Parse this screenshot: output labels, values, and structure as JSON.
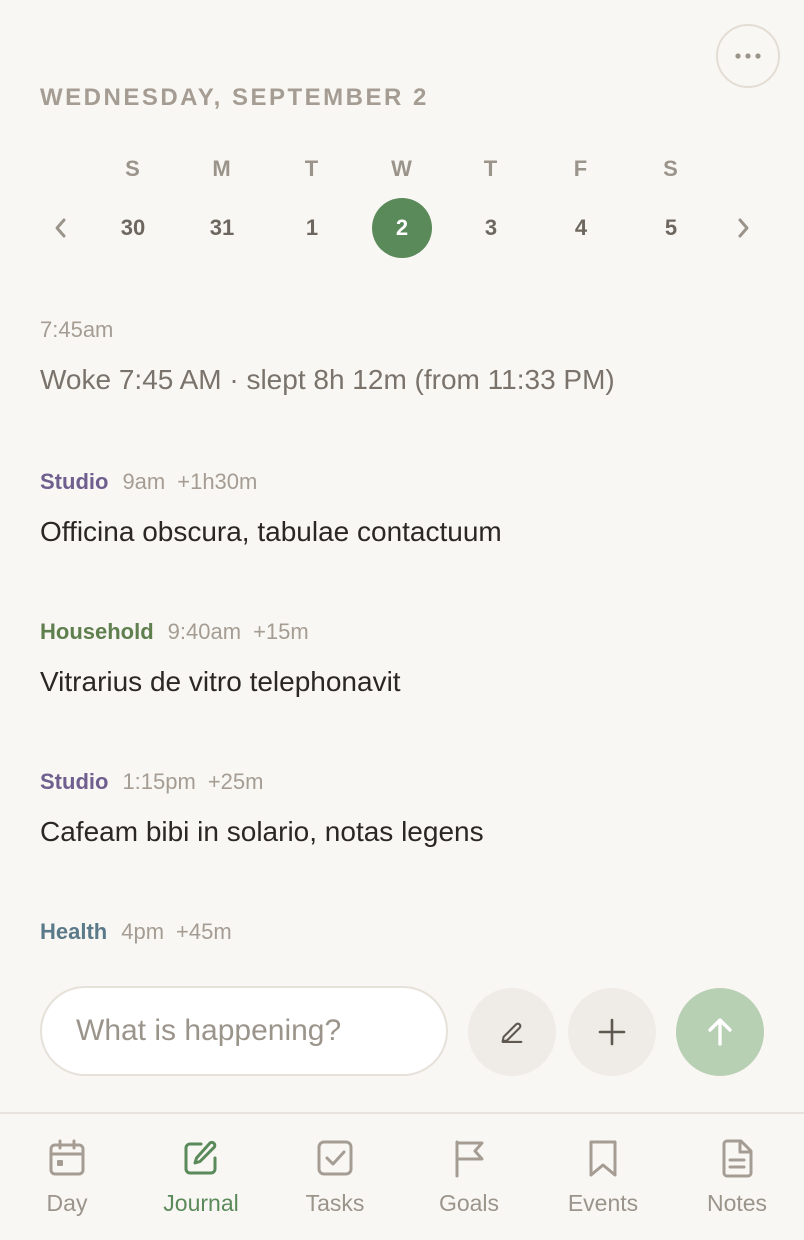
{
  "header": {
    "date": "WEDNESDAY, SEPTEMBER 2",
    "more_icon": "ellipsis-icon"
  },
  "week": {
    "days": [
      {
        "letter": "S",
        "num": "30"
      },
      {
        "letter": "M",
        "num": "31"
      },
      {
        "letter": "T",
        "num": "1"
      },
      {
        "letter": "W",
        "num": "2",
        "selected": true
      },
      {
        "letter": "T",
        "num": "3"
      },
      {
        "letter": "F",
        "num": "4"
      },
      {
        "letter": "S",
        "num": "5"
      }
    ],
    "prev_icon": "chevron-left-icon",
    "next_icon": "chevron-right-icon"
  },
  "entries": [
    {
      "time": "7:45am",
      "text": "Woke 7:45 AM · slept 8h 12m (from 11:33 PM)"
    },
    {
      "category": "Studio",
      "time": "9am",
      "duration": "+1h30m",
      "text": "Officina obscura, tabulae contactuum"
    },
    {
      "category": "Household",
      "time": "9:40am",
      "duration": "+15m",
      "text": "Vitrarius de vitro telephonavit"
    },
    {
      "category": "Studio",
      "time": "1:15pm",
      "duration": "+25m",
      "text": "Cafeam bibi in solario, notas legens"
    },
    {
      "category": "Health",
      "time": "4pm",
      "duration": "+45m",
      "text": ""
    }
  ],
  "composer": {
    "placeholder": "What is happening?",
    "value": ""
  },
  "tabs": [
    {
      "label": "Day",
      "icon": "calendar-icon"
    },
    {
      "label": "Journal",
      "icon": "edit-note-icon",
      "active": true
    },
    {
      "label": "Tasks",
      "icon": "checkbox-icon"
    },
    {
      "label": "Goals",
      "icon": "flag-icon"
    },
    {
      "label": "Events",
      "icon": "bookmark-icon"
    },
    {
      "label": "Notes",
      "icon": "document-icon"
    }
  ],
  "colors": {
    "accent_green": "#5a8a5a",
    "studio": "#6f5f8e",
    "household": "#5f7f4f",
    "health": "#5a7a8a",
    "muted": "#a59d93",
    "send_button": "#b7cfb3"
  }
}
